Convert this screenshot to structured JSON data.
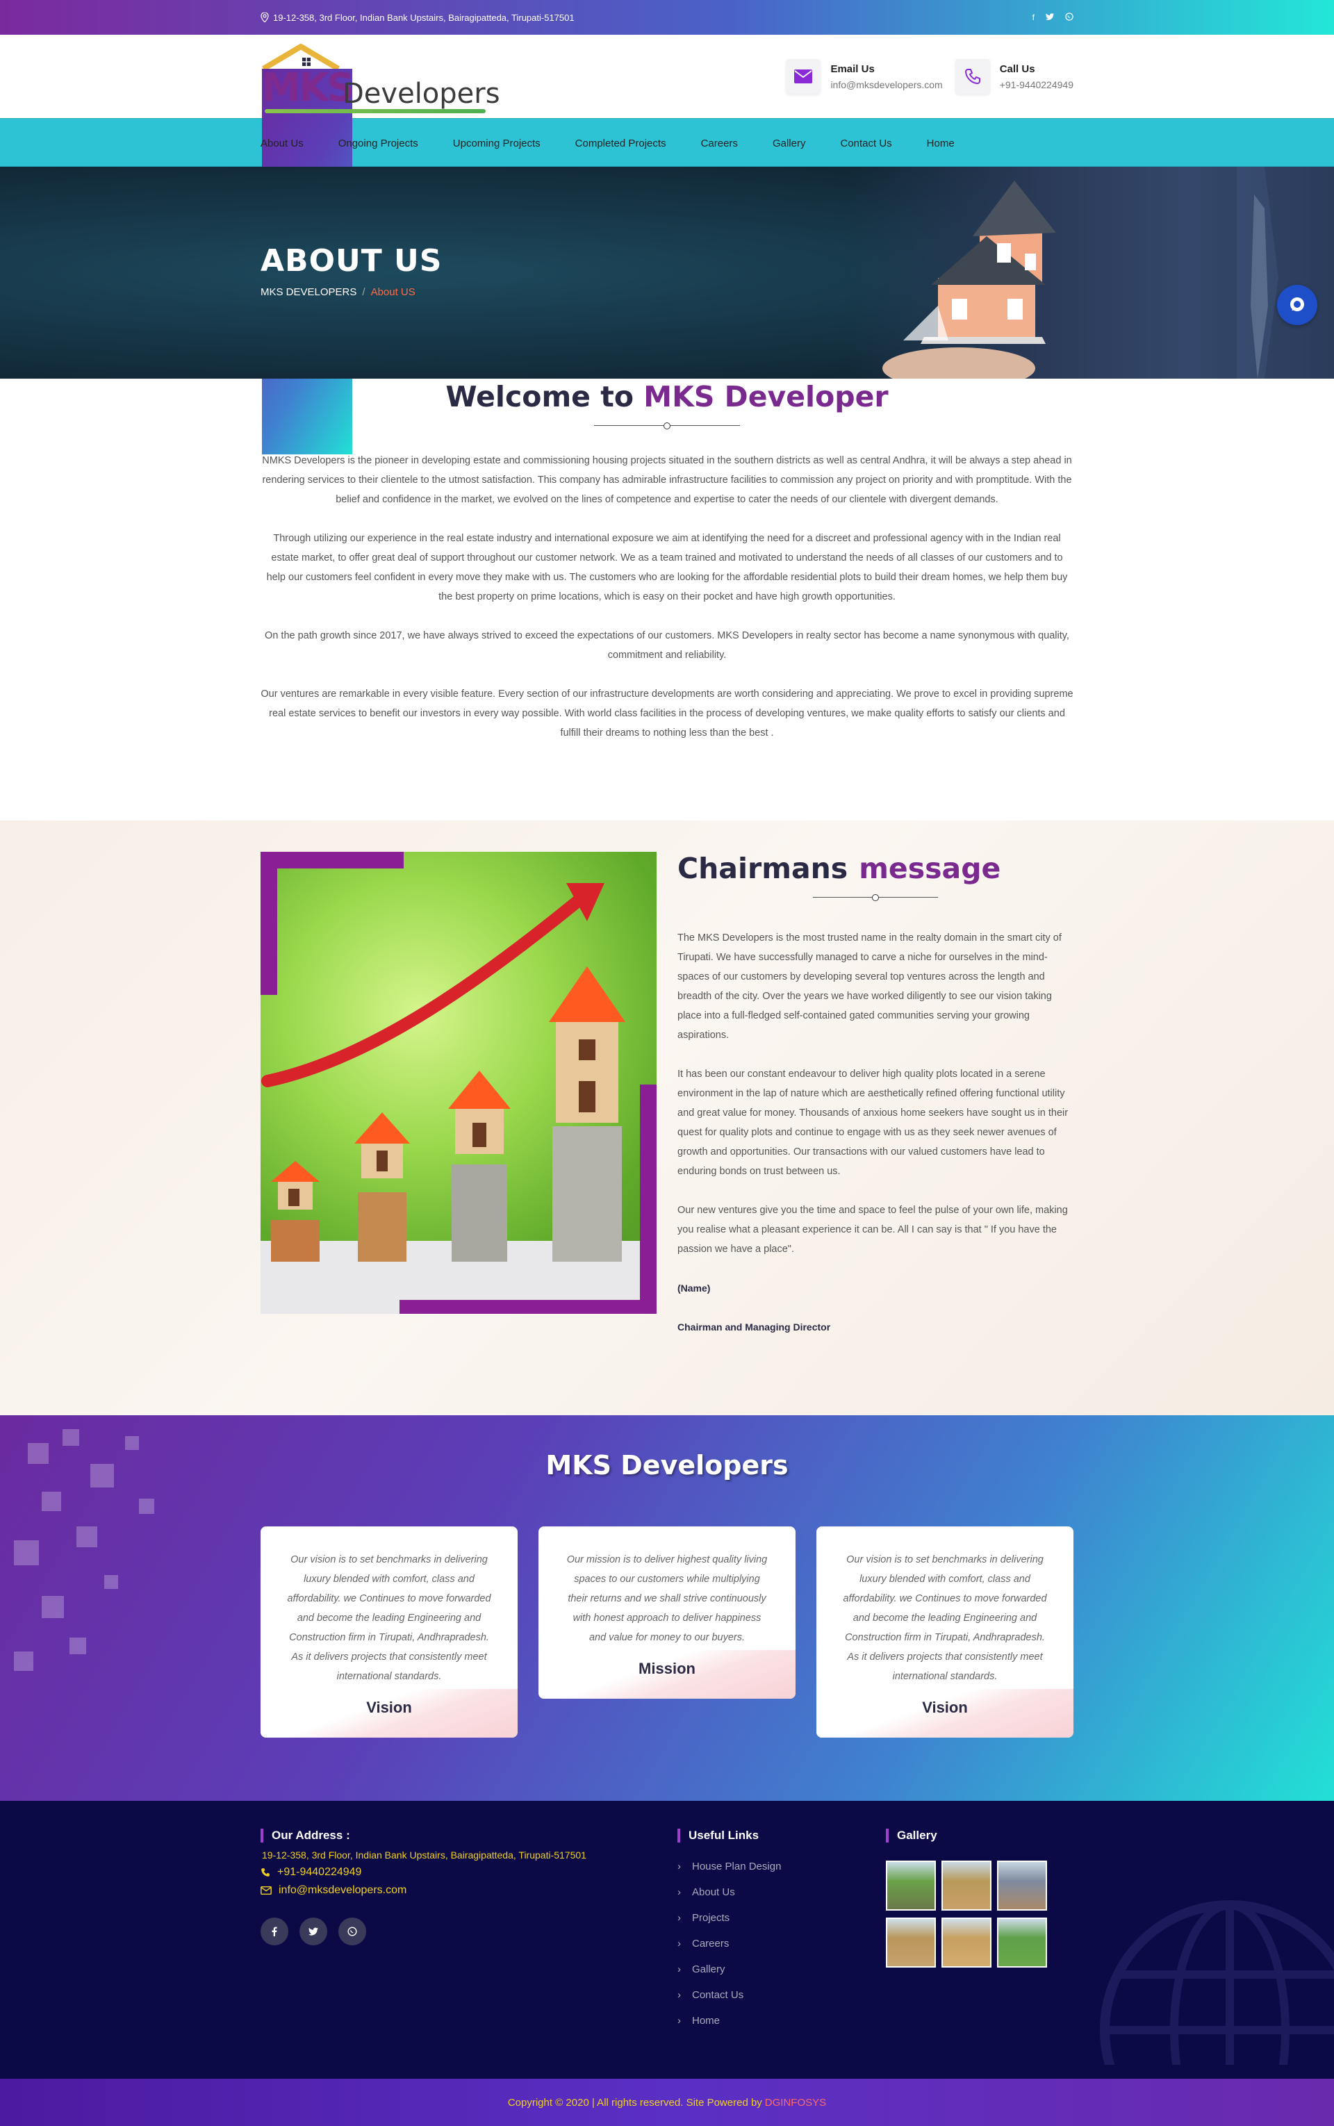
{
  "topbar": {
    "address": "19-12-358, 3rd Floor, Indian Bank Upstairs, Bairagipatteda, Tirupati-517501",
    "social_icons": [
      "facebook-icon",
      "twitter-icon",
      "whatsapp-icon"
    ]
  },
  "header": {
    "logo_mks": "MKS",
    "logo_developers": "Developers",
    "email": {
      "title": "Email Us",
      "value": "info@mksdevelopers.com"
    },
    "phone": {
      "title": "Call Us",
      "value": "+91-9440224949"
    }
  },
  "nav": {
    "items": [
      "About Us",
      "Ongoing Projects",
      "Upcoming Projects",
      "Completed Projects",
      "Careers",
      "Gallery",
      "Contact Us",
      "Home"
    ]
  },
  "banner": {
    "title": "ABOUT US",
    "crumb_home": "MKS DEVELOPERS",
    "crumb_sep": "/",
    "crumb_current": "About US"
  },
  "welcome": {
    "title_prefix": "Welcome to",
    "title_highlight": "MKS Developer",
    "paragraphs": [
      "NMKS Developers is the pioneer in developing estate and commissioning housing projects situated in the southern districts as well as central Andhra, it will be always a step ahead in rendering services to their clientele to the utmost satisfaction. This company has admirable infrastructure facilities to commission any project on priority and with promptitude. With the belief and confidence in the market, we evolved on the lines of competence and expertise to cater the needs of our clientele with divergent demands.",
      "Through utilizing our experience in the real estate industry and international exposure we aim at identifying the need for a discreet and professional agency with in the Indian real estate market, to offer great deal of support throughout our customer network. We as a team trained and motivated to understand the needs of all classes of our customers and to help our customers feel confident in every move they make with us. The customers who are looking for the affordable residential plots to build their dream homes, we help them buy the best property on prime locations, which is easy on their pocket and have high growth opportunities.",
      "On the path growth since 2017, we have always strived to exceed the expectations of our customers. MKS Developers in realty sector has become a name synonymous with quality, commitment and reliability.",
      "Our ventures are remarkable in every visible feature. Every section of our infrastructure developments are worth considering and appreciating. We prove to excel in providing supreme real estate services to benefit our investors in every way possible. With world class facilities in the process of developing ventures, we make quality efforts to satisfy our clients and fulfill their dreams to nothing less than the best ."
    ]
  },
  "chairman": {
    "title_prefix": "Chairmans",
    "title_highlight": "message",
    "paragraphs": [
      "The MKS Developers is the most trusted name in the realty domain in the smart city of Tirupati. We have successfully managed to carve a niche for ourselves in the mind-spaces of our customers by developing several top ventures across the length and breadth of the city. Over the years we have worked diligently to see our vision taking place into a full-fledged self-contained gated communities serving your growing aspirations.",
      "It has been our constant endeavour to deliver high quality plots located in a serene environment in the lap of nature which are aesthetically refined offering functional utility and great value for money. Thousands of anxious home seekers have sought us in their quest for quality plots and continue to engage with us as they seek newer avenues of growth and opportunities. Our transactions with our valued customers have lead to enduring bonds on trust between us.",
      "Our new ventures give you the time and space to feel the pulse of your own life, making you realise what a pleasant experience it can be. All I can say is that \" If you have the passion we have a place\"."
    ],
    "name": "(Name)",
    "role": "Chairman and Managing Director"
  },
  "mks_section": {
    "title": "MKS Developers",
    "cards": [
      {
        "text": "Our vision is to set benchmarks in delivering luxury blended with comfort, class and affordability. we Continues to move forwarded and become the leading Engineering and Construction firm in Tirupati, Andhrapradesh. As it delivers projects that consistently meet international standards.",
        "label": "Vision"
      },
      {
        "text": "Our mission is to deliver highest quality living spaces to our customers while multiplying their returns and we shall strive continuously with honest approach to deliver happiness and value for money to our buyers.",
        "label": "Mission"
      },
      {
        "text": "Our vision is to set benchmarks in delivering luxury blended with comfort, class and affordability. we Continues to move forwarded and become the leading Engineering and Construction firm in Tirupati, Andhrapradesh. As it delivers projects that consistently meet international standards.",
        "label": "Vision"
      }
    ]
  },
  "footer": {
    "address_title": "Our Address :",
    "address": "19-12-358, 3rd Floor, Indian Bank Upstairs, Bairagipatteda, Tirupati-517501",
    "phone": "+91-9440224949",
    "email": "info@mksdevelopers.com",
    "links_title": "Useful Links",
    "links": [
      "House Plan Design",
      "About Us",
      "Projects",
      "Careers",
      "Gallery",
      "Contact Us",
      "Home"
    ],
    "gallery_title": "Gallery"
  },
  "copyright": {
    "text": "Copyright © 2020 | All rights reserved. Site Powered by",
    "powered": "DGINFOSYS"
  },
  "colors": {
    "brand_purple": "#7a2a8f",
    "nav_cyan": "#2ec2d5",
    "footer_navy": "#0c0a46",
    "accent_yellow": "#f0d020"
  }
}
